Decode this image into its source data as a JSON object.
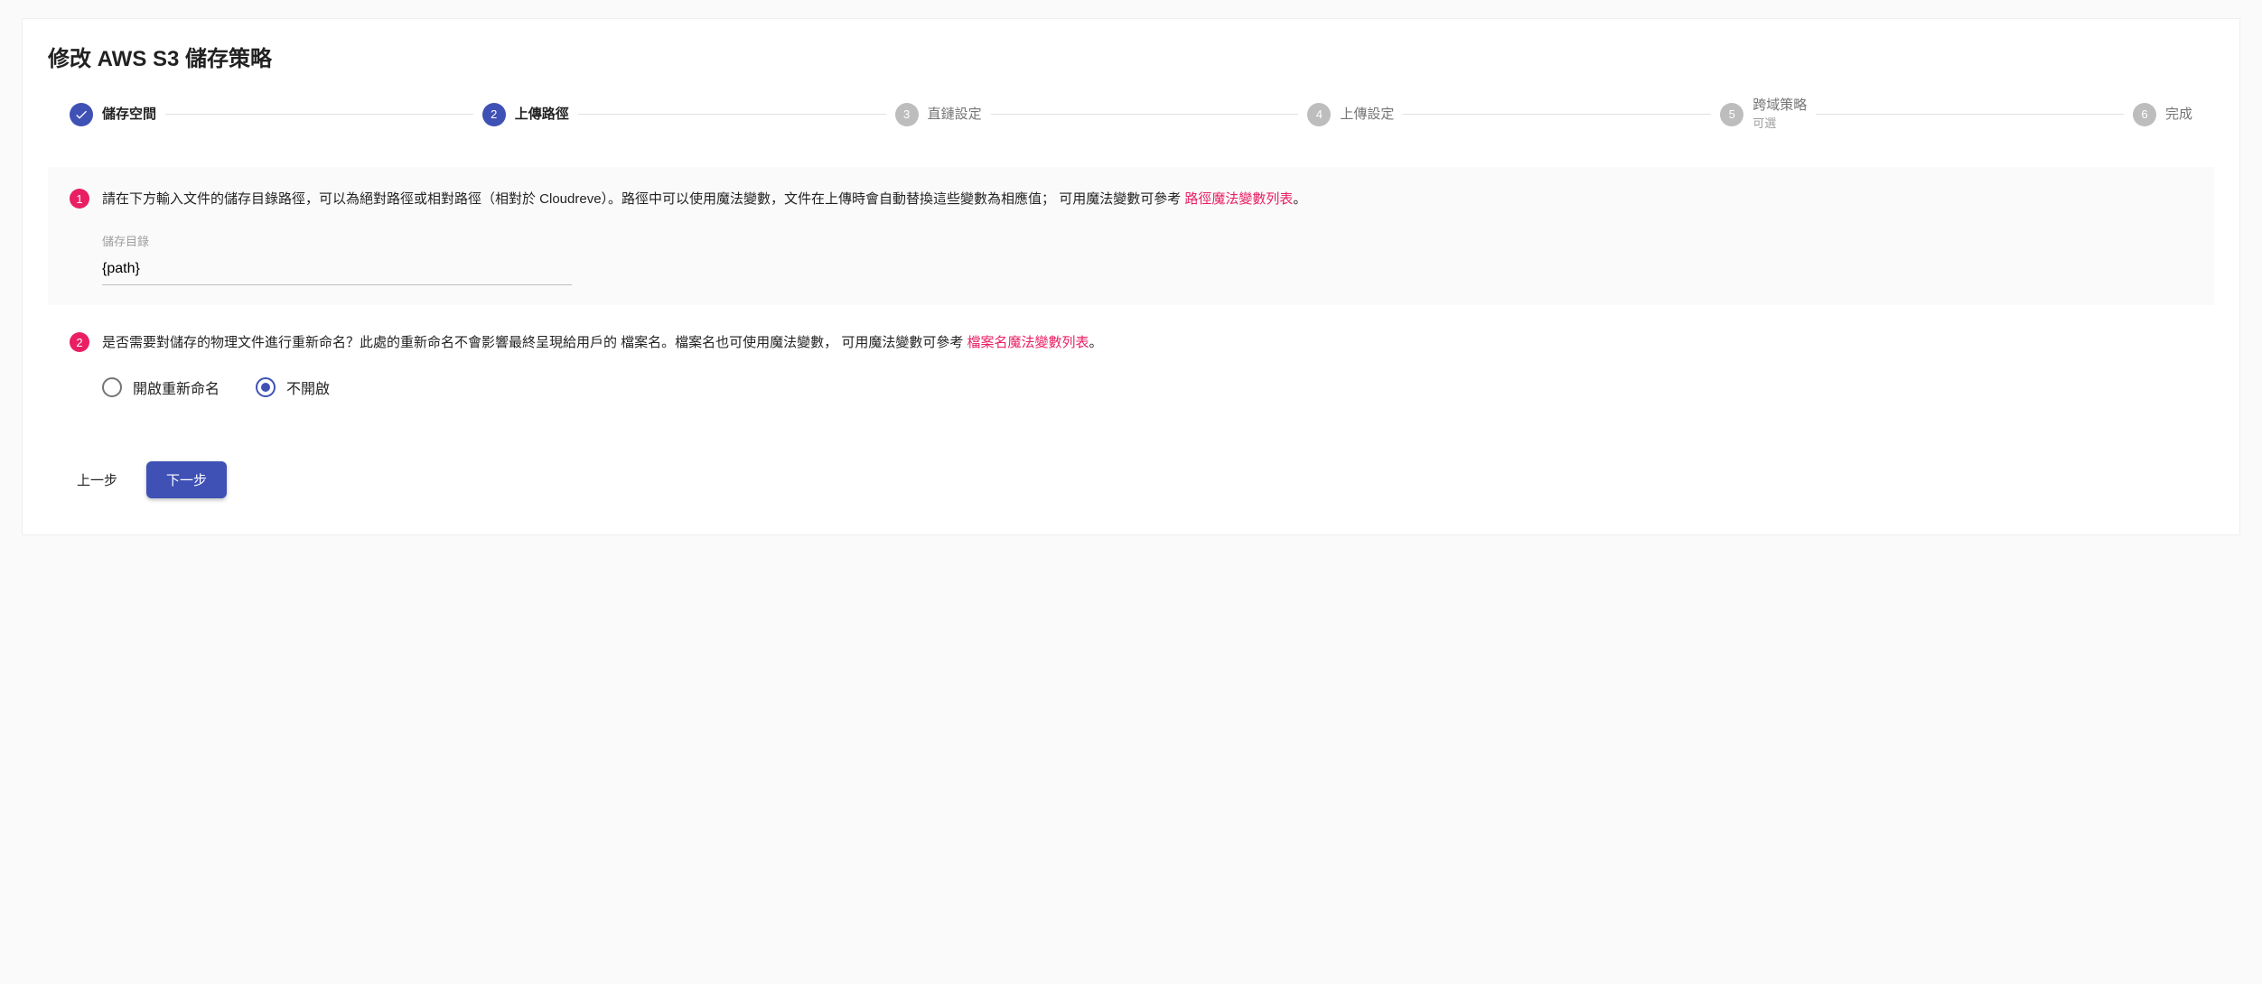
{
  "page": {
    "title": "修改 AWS S3 儲存策略"
  },
  "stepper": {
    "steps": [
      {
        "label": "儲存空間",
        "sub": "",
        "state": "done"
      },
      {
        "label": "上傳路徑",
        "sub": "",
        "state": "active",
        "num": "2"
      },
      {
        "label": "直鏈設定",
        "sub": "",
        "state": "pending",
        "num": "3"
      },
      {
        "label": "上傳設定",
        "sub": "",
        "state": "pending",
        "num": "4"
      },
      {
        "label": "跨域策略",
        "sub": "可選",
        "state": "pending",
        "num": "5"
      },
      {
        "label": "完成",
        "sub": "",
        "state": "pending",
        "num": "6"
      }
    ]
  },
  "section1": {
    "badge": "1",
    "desc_pre": "請在下方輸入文件的儲存目錄路徑，可以為絕對路徑或相對路徑（相對於 Cloudreve）。路徑中可以使用魔法變數，文件在上傳時會自動替換這些變數為相應值； 可用魔法變數可參考 ",
    "desc_link": "路徑魔法變數列表",
    "desc_post": "。",
    "field_label": "儲存目錄",
    "field_value": "{path}"
  },
  "section2": {
    "badge": "2",
    "desc_pre": "是否需要對儲存的物理文件進行重新命名？此處的重新命名不會影響最終呈現給用戶的 檔案名。檔案名也可使用魔法變數， 可用魔法變數可參考 ",
    "desc_link": "檔案名魔法變數列表",
    "desc_post": "。",
    "radio": {
      "opt1": "開啟重新命名",
      "opt2": "不開啟",
      "selected": "opt2"
    }
  },
  "buttons": {
    "back": "上一步",
    "next": "下一步"
  }
}
